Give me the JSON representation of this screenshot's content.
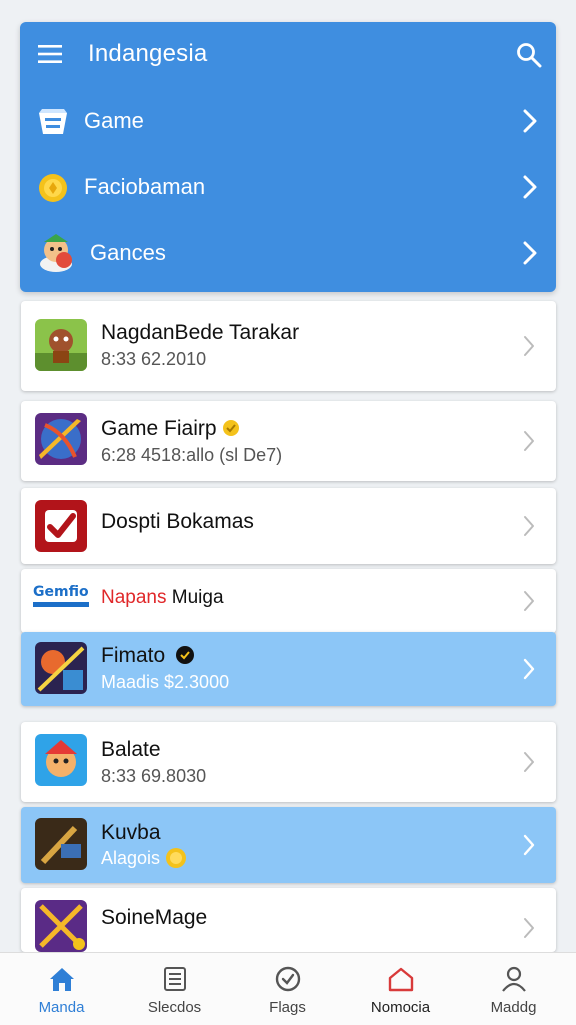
{
  "header": {
    "title": "Indangesia",
    "categories": [
      {
        "label": "Game",
        "icon": "game-basket-icon"
      },
      {
        "label": "Faciobaman",
        "icon": "coin-icon"
      },
      {
        "label": "Gances",
        "icon": "games-character-icon"
      }
    ]
  },
  "items": [
    {
      "title": "NagdanBede Tarakar",
      "subtitle": "8:33 62.2010",
      "icon": "brown-character-game-icon",
      "highlighted": false
    },
    {
      "title": "Game Fiairp",
      "subtitle": "6:28 4518:allo (sl De7)",
      "icon": "fantasy-blade-game-icon",
      "highlighted": false
    },
    {
      "title": "Dospti Bokamas",
      "subtitle": "",
      "icon": "red-checkmark-icon",
      "highlighted": false
    },
    {
      "title": "Napans",
      "title_suffix": "Muiga",
      "logo_text": "Gemfio",
      "subtitle": "",
      "icon": "gemfio-logo-icon",
      "highlighted": false
    },
    {
      "title": "Fimato",
      "subtitle": "Maadis  $2.3000",
      "icon": "battle-scene-game-icon",
      "highlighted": true
    },
    {
      "title": "Balate",
      "subtitle": "8:33 69.8030",
      "icon": "cartoon-hero-game-icon",
      "highlighted": false
    },
    {
      "title": "Kuvba",
      "subtitle": "Alagois",
      "icon": "hammer-game-icon",
      "highlighted": true
    },
    {
      "title": "SoineMage",
      "subtitle": "",
      "icon": "crossed-swords-game-icon",
      "highlighted": false
    }
  ],
  "nav": [
    {
      "label": "Manda",
      "icon": "home-icon",
      "active": true
    },
    {
      "label": "Slecdos",
      "icon": "list-icon",
      "active": false
    },
    {
      "label": "Flags",
      "icon": "check-circle-icon",
      "active": false
    },
    {
      "label": "Nomocia",
      "icon": "notification-house-icon",
      "active": false
    },
    {
      "label": "Maddg",
      "icon": "person-icon",
      "active": false
    }
  ],
  "colors": {
    "header_blue": "#3f8ee0",
    "highlight_blue": "#8cc6f7",
    "active_nav": "#2f7fd6",
    "napans_red": "#e0282a"
  }
}
